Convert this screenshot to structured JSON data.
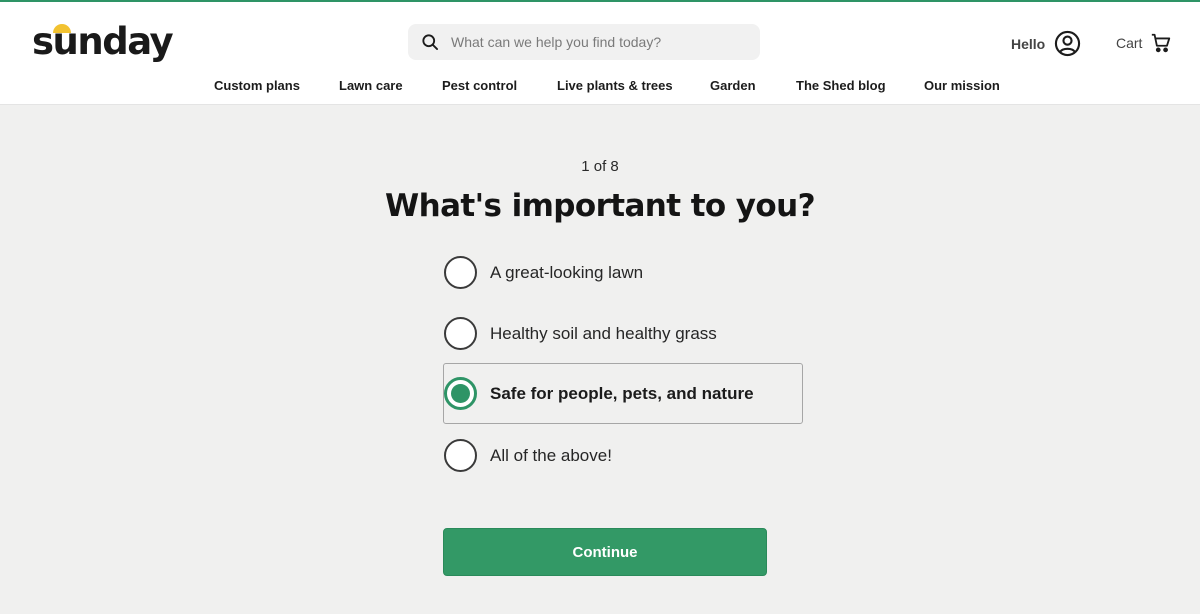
{
  "brand": {
    "logo_text": "sunday",
    "logo_accent_color": "#f2c230"
  },
  "search": {
    "placeholder": "What can we help you find today?"
  },
  "account": {
    "greeting": "Hello",
    "icon": "user-circle-icon"
  },
  "cart": {
    "label": "Cart",
    "icon": "shopping-cart-icon"
  },
  "nav": {
    "items": [
      {
        "label": "Custom plans"
      },
      {
        "label": "Lawn care"
      },
      {
        "label": "Pest control"
      },
      {
        "label": "Live plants & trees"
      },
      {
        "label": "Garden"
      },
      {
        "label": "The Shed blog"
      },
      {
        "label": "Our mission"
      }
    ]
  },
  "quiz": {
    "step": "1 of 8",
    "question": "What's important to you?",
    "options": [
      {
        "label": "A great-looking lawn",
        "selected": false
      },
      {
        "label": "Healthy soil and healthy grass",
        "selected": false
      },
      {
        "label": "Safe for people, pets, and nature",
        "selected": true
      },
      {
        "label": "All of the above!",
        "selected": false
      }
    ],
    "continue_label": "Continue"
  },
  "colors": {
    "accent": "#2e9466",
    "button": "#339966",
    "background": "#f0f0ef"
  }
}
